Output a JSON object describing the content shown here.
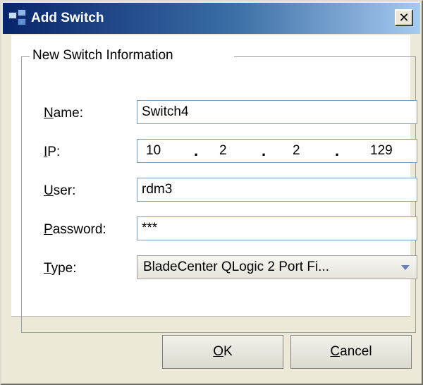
{
  "window": {
    "title": "Add Switch",
    "icon": "switch-app-icon",
    "close_glyph": "✕"
  },
  "group": {
    "legend": "New Switch Information"
  },
  "fields": {
    "name": {
      "label_mnemonic": "N",
      "label_rest": "ame:",
      "value": "Switch4"
    },
    "ip": {
      "label_mnemonic": "I",
      "label_rest": "P:",
      "octets": [
        "10",
        "2",
        "2",
        "129"
      ],
      "separator": "."
    },
    "user": {
      "label_mnemonic": "U",
      "label_rest": "ser:",
      "value": "rdm3"
    },
    "password": {
      "label_mnemonic": "P",
      "label_rest": "assword:",
      "value": "***"
    },
    "type": {
      "label_mnemonic": "T",
      "label_rest": "ype:",
      "value": "BladeCenter QLogic 2 Port Fi..."
    }
  },
  "buttons": {
    "ok": {
      "mnemonic": "O",
      "rest": "K"
    },
    "cancel": {
      "mnemonic": "C",
      "rest": "ancel"
    }
  },
  "colors": {
    "title_gradient_start": "#08246b",
    "title_gradient_end": "#a6caf0",
    "dialog_background": "#ece9d8"
  }
}
